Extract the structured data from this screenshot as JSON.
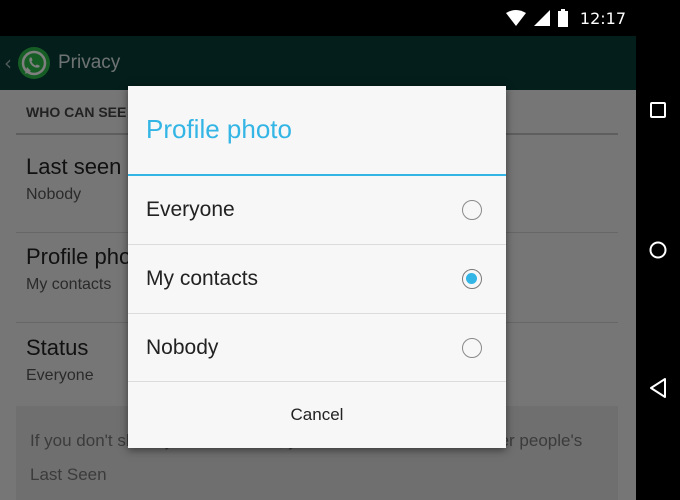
{
  "status_bar": {
    "time": "12:17",
    "icons": [
      "wifi-icon",
      "signal-icon",
      "battery-icon"
    ]
  },
  "action_bar": {
    "title": "Privacy"
  },
  "privacy_screen": {
    "section_header": "WHO CAN SEE MY PERSONAL INFO",
    "items": [
      {
        "title": "Last seen",
        "summary": "Nobody"
      },
      {
        "title": "Profile photo",
        "summary": "My contacts"
      },
      {
        "title": "Status",
        "summary": "Everyone"
      }
    ],
    "info_line1": "If you don't share your Last Seen, you won't be able to see other people's",
    "info_line2": "Last Seen"
  },
  "dialog": {
    "title": "Profile photo",
    "options": [
      {
        "label": "Everyone",
        "selected": false
      },
      {
        "label": "My contacts",
        "selected": true
      },
      {
        "label": "Nobody",
        "selected": false
      }
    ],
    "cancel_label": "Cancel"
  },
  "nav_bar": {
    "buttons": [
      "recents-icon",
      "home-icon",
      "back-icon"
    ]
  },
  "colors": {
    "accent": "#33b5e5",
    "action_bar": "#083c36",
    "whatsapp_green": "#2dbb4a"
  }
}
